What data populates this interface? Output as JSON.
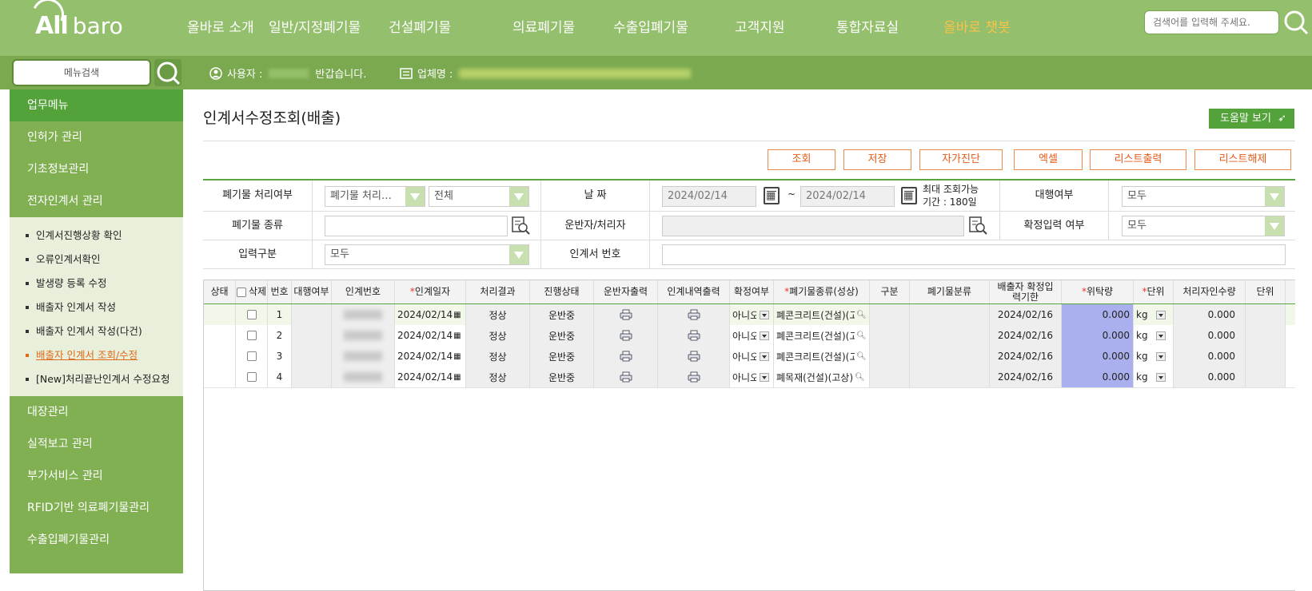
{
  "topnav": {
    "logo_all": "All",
    "logo_baro": "baro",
    "menu": [
      "올바로 소개",
      "일반/지정폐기물",
      "건설폐기물",
      "의료폐기물",
      "수출입폐기물",
      "고객지원",
      "통합자료실",
      "올바로 챗봇"
    ],
    "search_placeholder": "검색어를 입력해 주세요."
  },
  "subbar": {
    "menu_search_label": "메뉴검색",
    "user_label": "사용자 :",
    "greeting": "반갑습니다.",
    "company_label": "업체명 :"
  },
  "sidebar": {
    "head": "업무메뉴",
    "items_top": [
      "인허가 관리",
      "기초정보관리",
      "전자인계서 관리"
    ],
    "sub_items": [
      "인계서진행상황 확인",
      "오류인계서확인",
      "발생량 등록 수정",
      "배출자 인계서 작성",
      "배출자 인계서 작성(다건)",
      "배출자 인계서 조회/수정",
      "[New]처리끝난인계서 수정요청"
    ],
    "items_bottom": [
      "대장관리",
      "실적보고 관리",
      "부가서비스 관리",
      "RFID기반 의료폐기물관리",
      "수출입폐기물관리"
    ]
  },
  "page": {
    "title": "인계서수정조회(배출)",
    "help": "도움말 보기"
  },
  "actions": [
    "조회",
    "저장",
    "자가진단",
    "엑셀",
    "리스트출력",
    "리스트해제"
  ],
  "form": {
    "label_proc": "폐기물 처리여부",
    "proc_value": "폐기물 처리…",
    "proc_value2": "전체",
    "label_date": "날 짜",
    "date_from": "2024/02/14",
    "date_sep": "~",
    "date_to": "2024/02/14",
    "date_note1": "최대 조회가능",
    "date_note2": "기간 : 180일",
    "label_agent": "대행여부",
    "agent_value": "모두",
    "label_waste_type": "폐기물 종류",
    "label_carrier": "운반자/처리자",
    "label_confirm": "확정입력 여부",
    "confirm_value": "모두",
    "label_input_type": "입력구분",
    "input_type_value": "모두",
    "label_doc_no": "인계서 번호"
  },
  "grid": {
    "headers": {
      "status": "상태",
      "delete": "삭제",
      "no": "번호",
      "agent": "대행여부",
      "doc_no": "인계번호",
      "date": "인계일자",
      "result": "처리결과",
      "progress": "진행상태",
      "carrier_print": "운반자출력",
      "detail_print": "인계내역출력",
      "confirm": "확정여부",
      "waste_kind": "폐기물종류(성상)",
      "category": "구분",
      "waste_class": "폐기물분류",
      "deadline": "배출자 확정입력기한",
      "amount": "위탁량",
      "unit": "단위",
      "proc_amount": "처리자인수량",
      "unit2": "단위"
    },
    "rows": [
      {
        "no": "1",
        "date": "2024/02/14",
        "result": "정상",
        "progress": "운반중",
        "confirm": "아니오",
        "waste_kind": "폐콘크리트(건설)(고상)",
        "deadline": "2024/02/16",
        "amount": "0.000",
        "unit": "kg",
        "proc_amount": "0.000"
      },
      {
        "no": "2",
        "date": "2024/02/14",
        "result": "정상",
        "progress": "운반중",
        "confirm": "아니오",
        "waste_kind": "폐콘크리트(건설)(고상)",
        "deadline": "2024/02/16",
        "amount": "0.000",
        "unit": "kg",
        "proc_amount": "0.000"
      },
      {
        "no": "3",
        "date": "2024/02/14",
        "result": "정상",
        "progress": "운반중",
        "confirm": "아니오",
        "waste_kind": "폐콘크리트(건설)(고상)",
        "deadline": "2024/02/16",
        "amount": "0.000",
        "unit": "kg",
        "proc_amount": "0.000"
      },
      {
        "no": "4",
        "date": "2024/02/14",
        "result": "정상",
        "progress": "운반중",
        "confirm": "아니오",
        "waste_kind": "폐목재(건설)(고상)",
        "deadline": "2024/02/16",
        "amount": "0.000",
        "unit": "kg",
        "proc_amount": "0.000"
      }
    ]
  },
  "colors": {
    "nav_bg": "#94bf6c",
    "subbar_bg": "#7aa94f",
    "accent_green": "#53a23a",
    "accent_orange": "#e55a17",
    "amount_bg": "#aab0ee"
  }
}
